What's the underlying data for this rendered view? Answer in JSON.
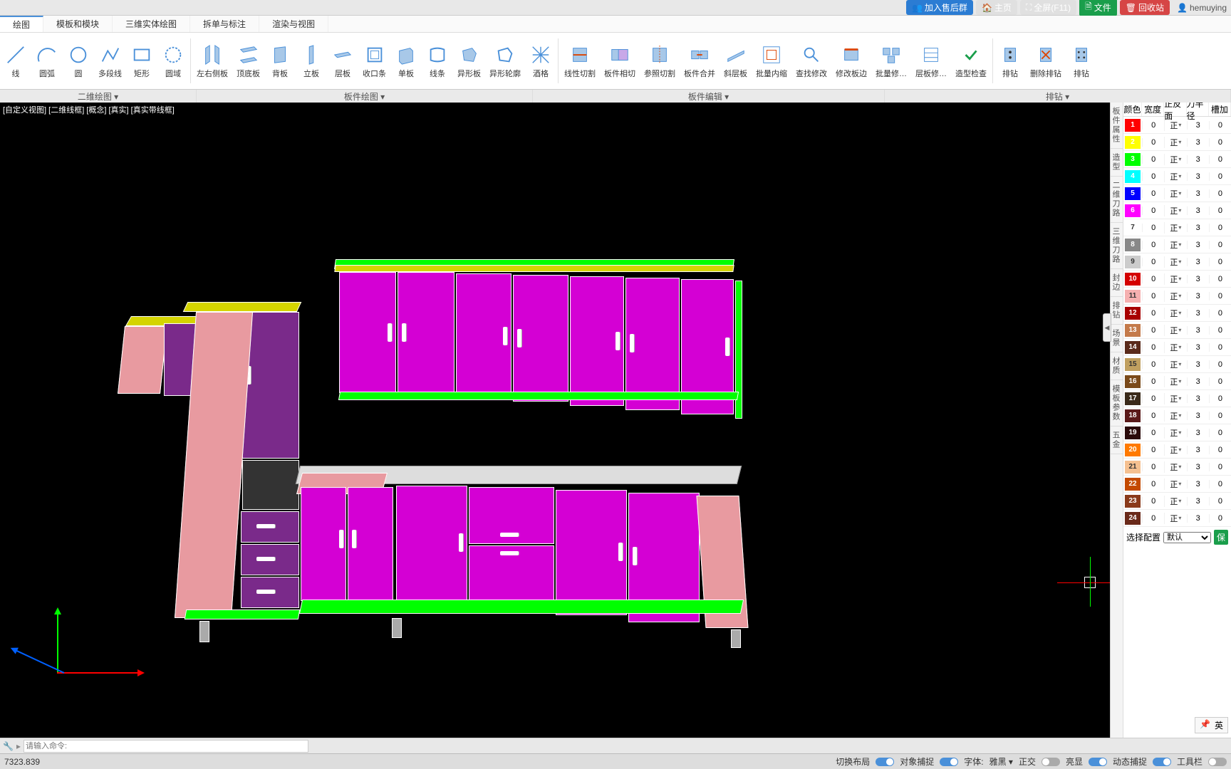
{
  "topbar": {
    "join": "加入售后群",
    "home": "主页",
    "fullscreen": "全屏(F11)",
    "file": "文件",
    "recycle": "回收站",
    "user": "hemuying"
  },
  "menu": {
    "t0": "绘图",
    "t1": "模板和模块",
    "t2": "三维实体绘图",
    "t3": "拆单与标注",
    "t4": "渲染与视图"
  },
  "ribbon": {
    "r0": "线",
    "r1": "圆弧",
    "r2": "圆",
    "r3": "多段线",
    "r4": "矩形",
    "r5": "圆域",
    "r6": "左右侧板",
    "r7": "顶底板",
    "r8": "背板",
    "r9": "立板",
    "r10": "层板",
    "r11": "收口条",
    "r12": "单板",
    "r13": "线条",
    "r14": "异形板",
    "r15": "异形轮廓",
    "r16": "酒格",
    "r17": "线性切割",
    "r18": "板件相切",
    "r19": "参照切割",
    "r20": "板件合并",
    "r21": "斜层板",
    "r22": "批量内缩",
    "r23": "查找修改",
    "r24": "修改板边",
    "r25": "批量修…",
    "r26": "层板修…",
    "r27": "造型检查",
    "r28": "排钻",
    "r29": "删除排钻",
    "r30": "排钻"
  },
  "groups": {
    "g0": "二维绘图 ▾",
    "g1": "板件绘图 ▾",
    "g2": "板件编辑 ▾",
    "g3": "排钻 ▾"
  },
  "viewport": {
    "header": "[自定义视图] [二维线框] [概念] [真实] [真实带线框]"
  },
  "panel": {
    "headers": {
      "c0": "颜色",
      "c1": "宽度",
      "c2": "正反面",
      "c3": "刀半径",
      "c4": "槽加"
    },
    "rows": [
      {
        "n": "1",
        "color": "#ff0000",
        "w": "0",
        "f": "正",
        "r": "3",
        "g": "0"
      },
      {
        "n": "2",
        "color": "#ffff00",
        "w": "0",
        "f": "正",
        "r": "3",
        "g": "0"
      },
      {
        "n": "3",
        "color": "#00ff00",
        "w": "0",
        "f": "正",
        "r": "3",
        "g": "0"
      },
      {
        "n": "4",
        "color": "#00ffff",
        "w": "0",
        "f": "正",
        "r": "3",
        "g": "0"
      },
      {
        "n": "5",
        "color": "#0000ff",
        "w": "0",
        "f": "正",
        "r": "3",
        "g": "0"
      },
      {
        "n": "6",
        "color": "#ff00ff",
        "w": "0",
        "f": "正",
        "r": "3",
        "g": "0"
      },
      {
        "n": "7",
        "color": "#ffffff",
        "tc": "#333",
        "w": "0",
        "f": "正",
        "r": "3",
        "g": "0"
      },
      {
        "n": "8",
        "color": "#888888",
        "w": "0",
        "f": "正",
        "r": "3",
        "g": "0"
      },
      {
        "n": "9",
        "color": "#cccccc",
        "tc": "#333",
        "w": "0",
        "f": "正",
        "r": "3",
        "g": "0"
      },
      {
        "n": "10",
        "color": "#d40000",
        "w": "0",
        "f": "正",
        "r": "3",
        "g": "0"
      },
      {
        "n": "11",
        "color": "#f5b0b0",
        "tc": "#333",
        "w": "0",
        "f": "正",
        "r": "3",
        "g": "0"
      },
      {
        "n": "12",
        "color": "#a80000",
        "w": "0",
        "f": "正",
        "r": "3",
        "g": "0"
      },
      {
        "n": "13",
        "color": "#c47a4a",
        "w": "0",
        "f": "正",
        "r": "3",
        "g": "0"
      },
      {
        "n": "14",
        "color": "#5a2a1a",
        "w": "0",
        "f": "正",
        "r": "3",
        "g": "0"
      },
      {
        "n": "15",
        "color": "#c0a060",
        "tc": "#333",
        "w": "0",
        "f": "正",
        "r": "3",
        "g": "0"
      },
      {
        "n": "16",
        "color": "#7a4a1a",
        "w": "0",
        "f": "正",
        "r": "3",
        "g": "0"
      },
      {
        "n": "17",
        "color": "#3a2a1a",
        "w": "0",
        "f": "正",
        "r": "3",
        "g": "0"
      },
      {
        "n": "18",
        "color": "#5a1a1a",
        "w": "0",
        "f": "正",
        "r": "3",
        "g": "0"
      },
      {
        "n": "19",
        "color": "#2a0a0a",
        "w": "0",
        "f": "正",
        "r": "3",
        "g": "0"
      },
      {
        "n": "20",
        "color": "#ff7a00",
        "w": "0",
        "f": "正",
        "r": "3",
        "g": "0"
      },
      {
        "n": "21",
        "color": "#f5c090",
        "tc": "#333",
        "w": "0",
        "f": "正",
        "r": "3",
        "g": "0"
      },
      {
        "n": "22",
        "color": "#c44a00",
        "w": "0",
        "f": "正",
        "r": "3",
        "g": "0"
      },
      {
        "n": "23",
        "color": "#8a3a1a",
        "w": "0",
        "f": "正",
        "r": "3",
        "g": "0"
      },
      {
        "n": "24",
        "color": "#6a2a1a",
        "w": "0",
        "f": "正",
        "r": "3",
        "g": "0"
      }
    ],
    "vtabs": {
      "v0": "板件属性",
      "v1": "造型",
      "v2": "二维刀路",
      "v3": "三维刀路",
      "v4": "封边",
      "v5": "排钻",
      "v6": "场景",
      "v7": "材质",
      "v8": "模板参数",
      "v9": "五金"
    },
    "config_label": "选择配置",
    "config_value": "默认",
    "save": "保"
  },
  "ime": {
    "pin": "📌",
    "lang": "英"
  },
  "cmd": {
    "placeholder": "请输入命令:",
    "coord": "7323.839"
  },
  "status": {
    "s0": "切换布局",
    "s1": "对象捕捉",
    "s2": "字体:",
    "s3": "雅黑 ▾",
    "s4": "正交",
    "s5": "亮显",
    "s6": "动态捕捉",
    "s7": "工具栏"
  }
}
